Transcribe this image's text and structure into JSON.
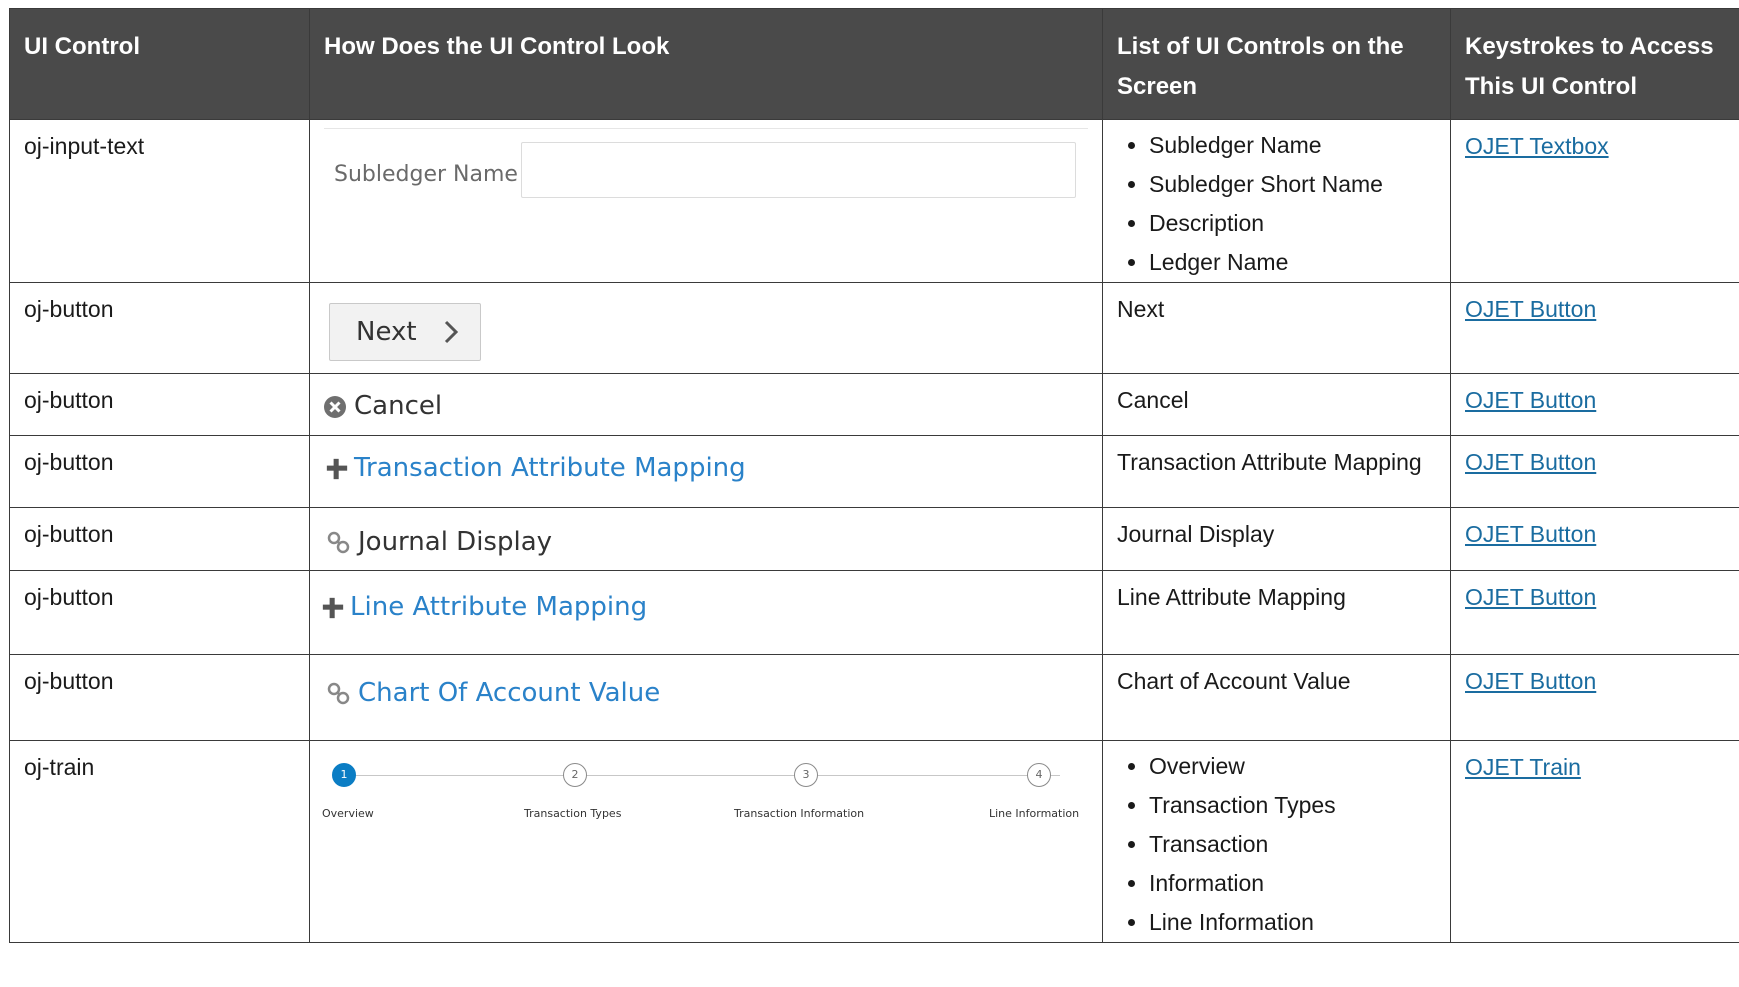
{
  "headers": {
    "col1": "UI Control",
    "col2": "How Does the UI Control Look",
    "col3": "List of UI Controls on the Screen",
    "col4": "Keystrokes to Access This UI Control"
  },
  "rows": [
    {
      "control": "oj-input-text",
      "preview": {
        "label": "Subledger Name"
      },
      "items": [
        "Subledger Name",
        "Subledger Short Name",
        "Description",
        "Ledger Name"
      ],
      "link": "OJET Textbox"
    },
    {
      "control": "oj-button",
      "preview": {
        "label": "Next"
      },
      "list": "Next",
      "link": "OJET Button"
    },
    {
      "control": "oj-button",
      "preview": {
        "label": "Cancel"
      },
      "list": "Cancel",
      "link": "OJET Button"
    },
    {
      "control": "oj-button",
      "preview": {
        "label": "Transaction Attribute Mapping"
      },
      "list": "Transaction Attribute Mapping",
      "link": "OJET Button"
    },
    {
      "control": "oj-button",
      "preview": {
        "label": "Journal Display"
      },
      "list": "Journal Display",
      "link": "OJET Button"
    },
    {
      "control": "oj-button",
      "preview": {
        "label": "Line Attribute Mapping"
      },
      "list": "Line Attribute Mapping",
      "link": "OJET Button"
    },
    {
      "control": "oj-button",
      "preview": {
        "label": "Chart Of Account Value"
      },
      "list": "Chart of Account Value",
      "link": "OJET Button"
    },
    {
      "control": "oj-train",
      "preview": {
        "steps": [
          {
            "num": "1",
            "label": "Overview"
          },
          {
            "num": "2",
            "label": "Transaction Types"
          },
          {
            "num": "3",
            "label": "Transaction Information"
          },
          {
            "num": "4",
            "label": "Line Information"
          }
        ]
      },
      "items": [
        "Overview",
        "Transaction Types",
        "Transaction",
        "Information",
        "Line Information"
      ],
      "link": "OJET Train"
    }
  ],
  "colors": {
    "header_bg": "#4a4a4a",
    "link": "#1a6ca0",
    "accent": "#2a82c9",
    "train_active": "#0b7dc4"
  }
}
